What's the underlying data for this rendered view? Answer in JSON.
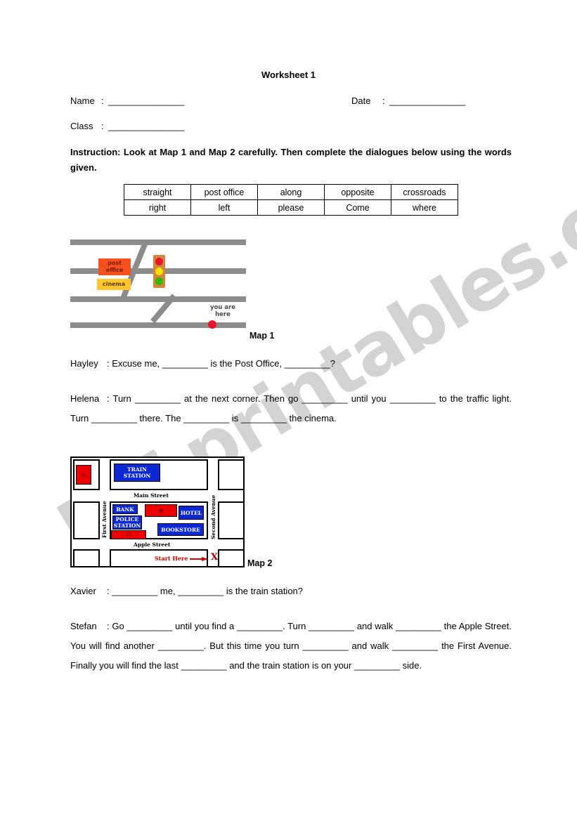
{
  "document": {
    "title": "Worksheet 1"
  },
  "fields": {
    "name": {
      "label": "Name",
      "colon": ":",
      "blank": "_______________"
    },
    "date": {
      "label": "Date",
      "colon": ":",
      "blank": "_______________"
    },
    "class": {
      "label": "Class",
      "colon": ":",
      "blank": "_______________"
    }
  },
  "instruction": {
    "text": "Instruction: Look at Map 1 and Map 2 carefully. Then complete the dialogues below using the words given."
  },
  "wordbank": {
    "rows": [
      [
        "straight",
        "post office",
        "along",
        "opposite",
        "crossroads"
      ],
      [
        "right",
        "left",
        "please",
        "Come",
        "where"
      ]
    ]
  },
  "map1": {
    "label": "Map 1",
    "post_office": "post office",
    "cinema": "cinema",
    "you_are_here": "you are here",
    "colors": {
      "road": "#8c8c8c",
      "post_office": "#f4511e",
      "cinema": "#ffc72c",
      "traffic_light_housing": "#d2853c",
      "light_red": "#e8152c",
      "light_yellow": "#f5e000",
      "light_green": "#2fbb00",
      "marker_dot": "#e8152c"
    }
  },
  "map2": {
    "label": "Map 2",
    "streets": {
      "main": "Main Street",
      "apple": "Apple Street",
      "first": "First Avenue",
      "second": "Second Avenue"
    },
    "buildings": {
      "a": "A",
      "b": "B",
      "c": "C",
      "train_station": "TRAIN STATION",
      "bank": "BANK",
      "police_station": "POLICE STATION",
      "hotel": "HOTEL",
      "bookstore": "BOOKSTORE"
    },
    "start_here": "Start Here",
    "x_marker": "X",
    "colors": {
      "building_blue": "#0b28d4",
      "building_red": "#ee0000",
      "start_red": "#cc0000",
      "x_red": "#aa0000"
    }
  },
  "dialogue1": {
    "line1": {
      "speaker": "Hayley",
      "colon": ":",
      "text": "Excuse me, _________ is the Post Office, _________?"
    },
    "line2": {
      "speaker": "Helena",
      "colon": ":",
      "text": "Turn _________ at the next corner. Then go _________ until you _________ to the traffic light. Turn _________ there. The _________ is _________ the cinema."
    }
  },
  "dialogue2": {
    "line1": {
      "speaker": "Xavier",
      "colon": ":",
      "text": "_________ me, _________ is the train station?"
    },
    "line2": {
      "speaker": "Stefan",
      "colon": ":",
      "text": "Go _________ until you find a _________. Turn _________ and walk _________ the Apple Street. You will find another _________. But this time you turn _________ and walk _________ the First Avenue. Finally you will find the last _________ and the train station is on your _________ side."
    }
  },
  "watermark": {
    "text": "ESLprintables.com"
  }
}
